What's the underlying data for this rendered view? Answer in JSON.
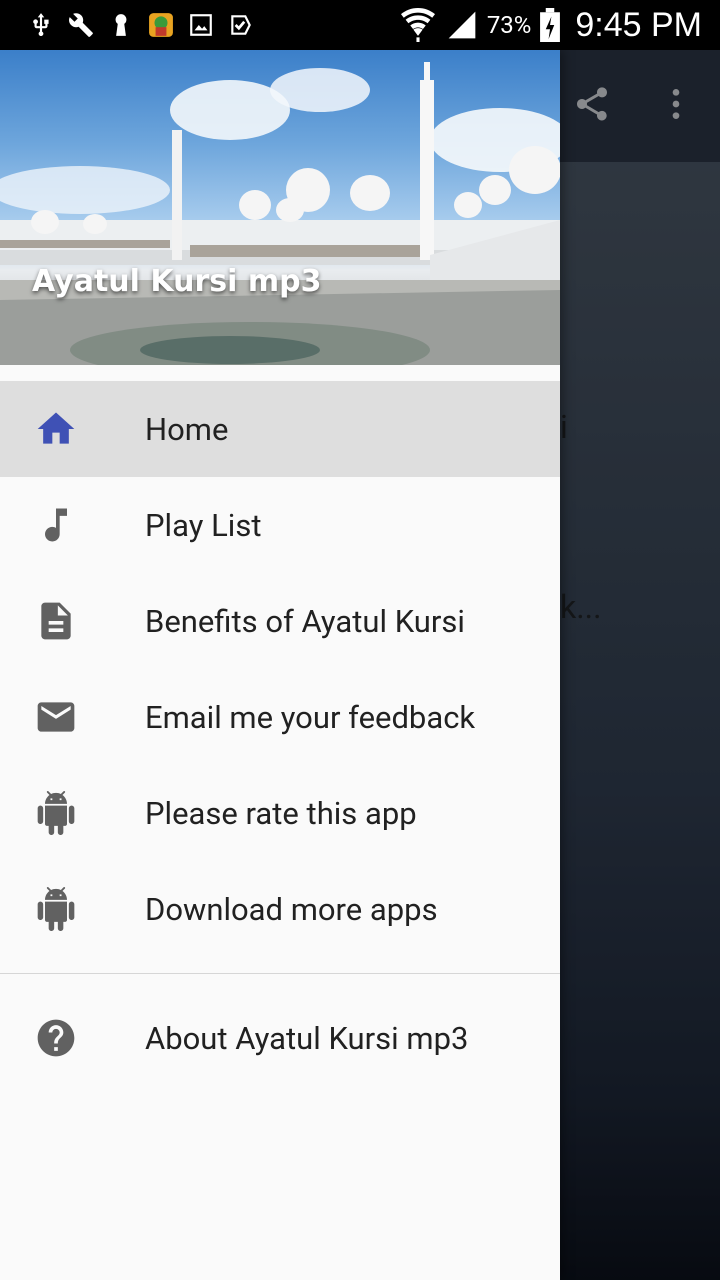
{
  "status_bar": {
    "battery_percent": "73%",
    "time": "9:45 PM",
    "left_icons": [
      "usb-icon",
      "wrench-icon",
      "keyhole-icon",
      "game-app-icon",
      "image-icon",
      "checkmark-icon"
    ]
  },
  "app": {
    "background_text": [
      "i",
      "k..."
    ]
  },
  "drawer": {
    "title": "Ayatul Kursi mp3",
    "items": [
      {
        "label": "Home",
        "icon": "home-icon",
        "active": true
      },
      {
        "label": "Play List",
        "icon": "music-note-icon"
      },
      {
        "label": "Benefits of Ayatul Kursi",
        "icon": "document-icon"
      },
      {
        "label": "Email me your feedback",
        "icon": "email-icon"
      },
      {
        "label": "Please rate this app",
        "icon": "android-icon"
      },
      {
        "label": "Download more apps",
        "icon": "android-icon"
      }
    ],
    "footer_items": [
      {
        "label": "About Ayatul Kursi mp3",
        "icon": "help-icon"
      }
    ]
  },
  "colors": {
    "accent": "#3f51b5",
    "icon_gray": "#616161",
    "active_bg": "#dedede",
    "drawer_bg": "#fafafa"
  }
}
